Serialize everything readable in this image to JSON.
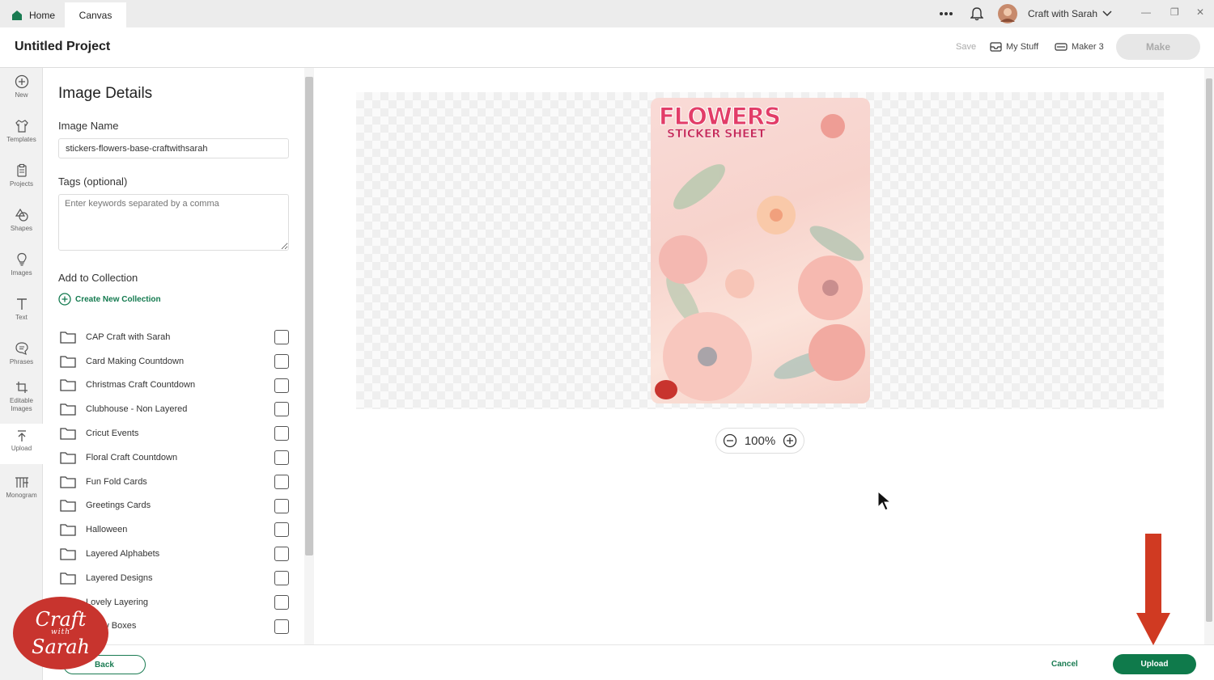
{
  "titlebar": {
    "tabs": [
      {
        "label": "Home"
      },
      {
        "label": "Canvas"
      }
    ],
    "user_name": "Craft with Sarah"
  },
  "header": {
    "project_title": "Untitled Project",
    "save_label": "Save",
    "my_stuff_label": "My Stuff",
    "machine_label": "Maker 3",
    "make_label": "Make"
  },
  "toolbar": {
    "items": [
      {
        "label": "New",
        "icon": "plus-circle-icon"
      },
      {
        "label": "Templates",
        "icon": "shirt-icon"
      },
      {
        "label": "Projects",
        "icon": "clipboard-icon"
      },
      {
        "label": "Shapes",
        "icon": "shapes-icon"
      },
      {
        "label": "Images",
        "icon": "bulb-icon"
      },
      {
        "label": "Text",
        "icon": "text-icon"
      },
      {
        "label": "Phrases",
        "icon": "speech-bubble-icon"
      },
      {
        "label": "Editable Images",
        "icon": "editable-images-icon"
      },
      {
        "label": "Upload",
        "icon": "upload-icon"
      },
      {
        "label": "Monogram",
        "icon": "monogram-icon"
      }
    ]
  },
  "panel": {
    "title": "Image Details",
    "image_name_label": "Image Name",
    "image_name_value": "stickers-flowers-base-craftwithsarah",
    "tags_label": "Tags (optional)",
    "tags_placeholder": "Enter keywords separated by a comma",
    "collection_label": "Add to Collection",
    "create_collection_label": "Create New Collection",
    "collections": [
      {
        "name": "CAP Craft with Sarah"
      },
      {
        "name": "Card Making Countdown"
      },
      {
        "name": "Christmas Craft Countdown"
      },
      {
        "name": "Clubhouse - Non Layered"
      },
      {
        "name": "Cricut Events"
      },
      {
        "name": "Floral Craft Countdown"
      },
      {
        "name": "Fun Fold Cards"
      },
      {
        "name": "Greetings Cards"
      },
      {
        "name": "Halloween"
      },
      {
        "name": "Layered Alphabets"
      },
      {
        "name": "Layered Designs"
      },
      {
        "name": "Lovely Layering"
      },
      {
        "name": "Pillow Boxes"
      }
    ]
  },
  "canvas": {
    "sheet_title": "FLOWERS",
    "sheet_subtitle": "STICKER SHEET",
    "zoom_value": "100%"
  },
  "footer": {
    "back_label": "Back",
    "cancel_label": "Cancel",
    "upload_label": "Upload"
  },
  "watermark": {
    "line1": "Craft",
    "line2": "with",
    "line3": "Sarah"
  },
  "colors": {
    "accent": "#0f7a4b",
    "arrow": "#d03a22"
  }
}
